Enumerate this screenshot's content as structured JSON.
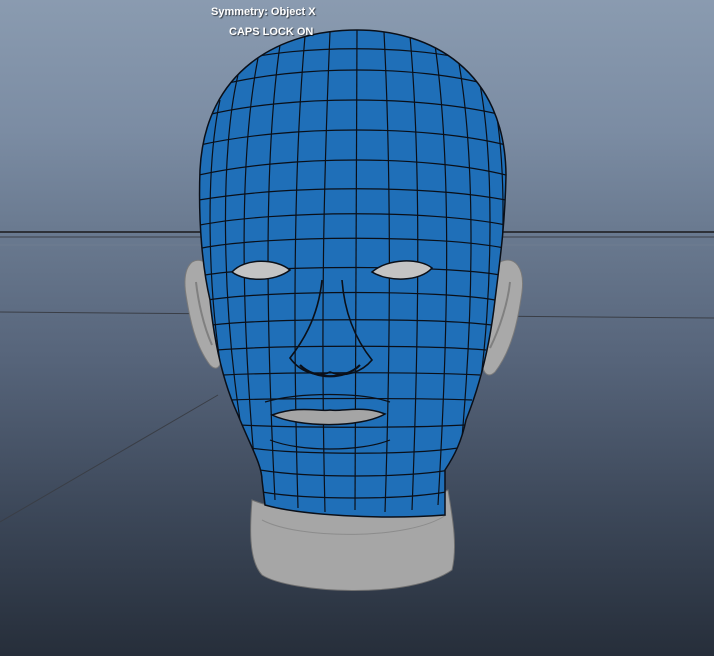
{
  "hud": {
    "symmetry_label": "Symmetry: Object X",
    "caps_lock_label": "CAPS LOCK ON"
  },
  "viewport": {
    "selected_object": "head-mesh",
    "colors": {
      "mesh_selected": "#1f6fb8",
      "mesh_unselected": "#a8a8a8",
      "wireframe": "#0a0f18",
      "grid_line": "#30343c",
      "background_top": "#8a9bb0",
      "background_bottom": "#262e3a"
    }
  }
}
